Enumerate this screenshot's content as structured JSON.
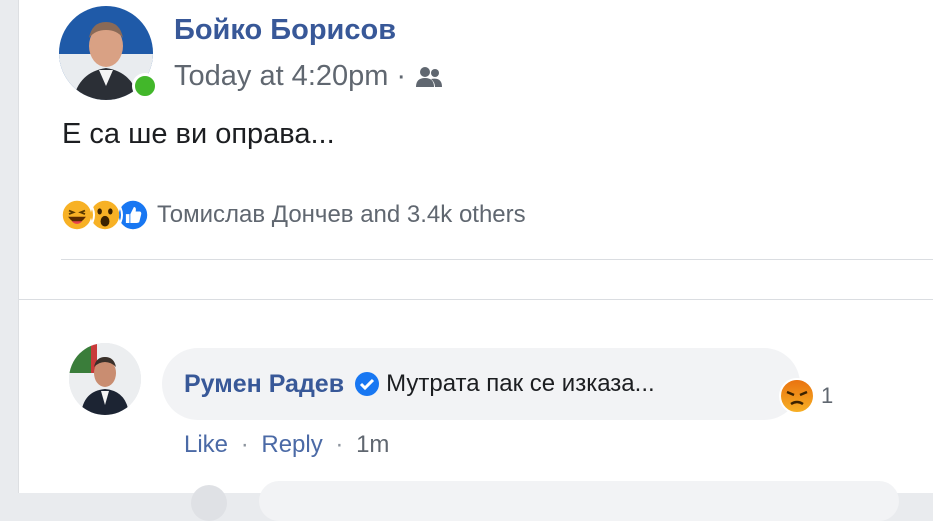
{
  "post": {
    "author": "Бойко Борисов",
    "timestamp": "Today at 4:20pm",
    "separator": "·",
    "audience_icon": "friends-icon",
    "text": "Е са ше ви оправа...",
    "reactions": {
      "types": [
        "haha",
        "wow",
        "like"
      ],
      "label": "Томислав Дончев and 3.4k others"
    }
  },
  "comment": {
    "author": "Румен Радев",
    "verified_icon": "verified-badge-icon",
    "text": "Мутрата пак се изказа...",
    "reaction_type": "angry",
    "reaction_count": "1",
    "actions": {
      "like": "Like",
      "reply": "Reply",
      "separator": "·",
      "time": "1m"
    }
  },
  "colors": {
    "link_blue": "#385898",
    "like_blue": "#1877f2",
    "online_green": "#42b72a",
    "bubble_bg": "#f2f3f5"
  }
}
